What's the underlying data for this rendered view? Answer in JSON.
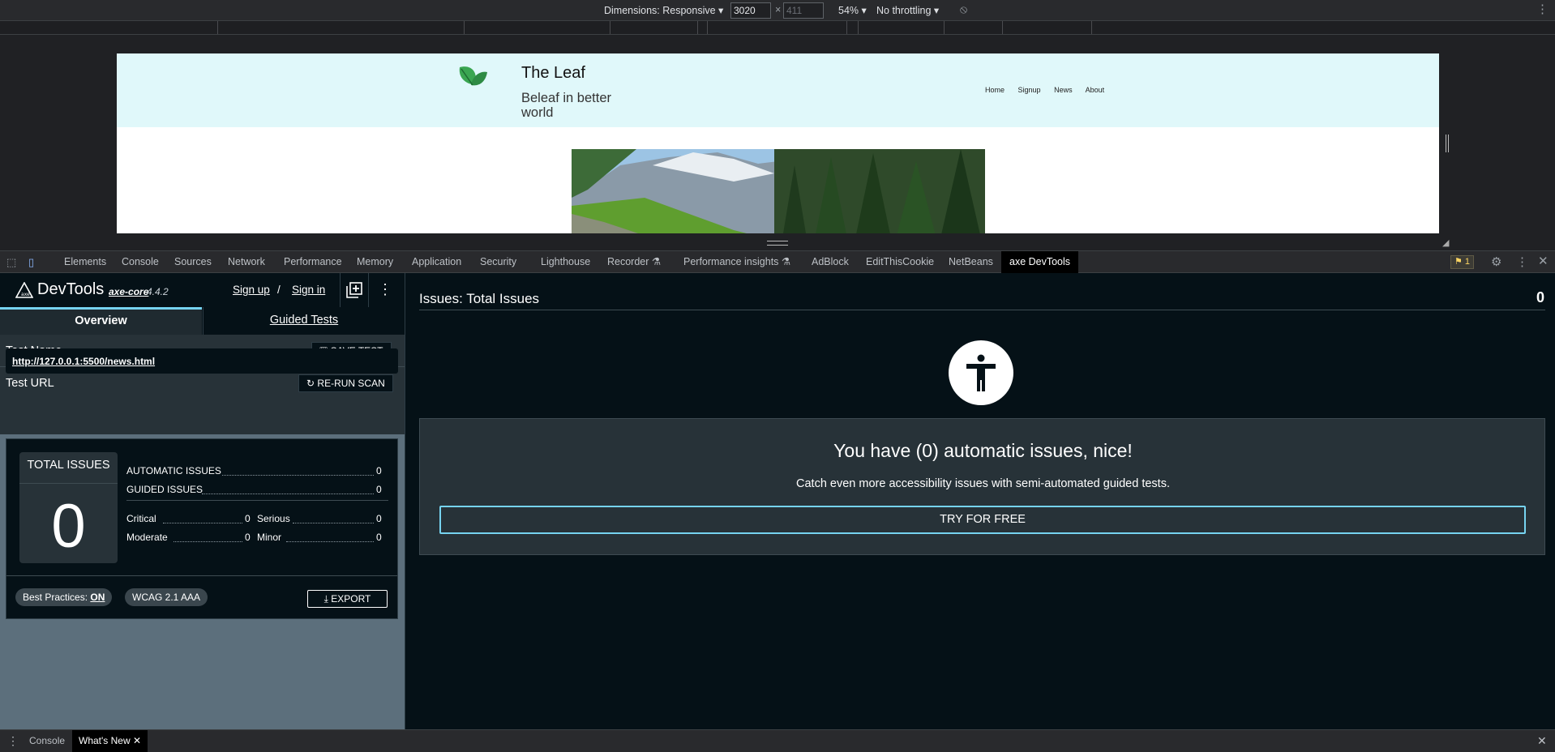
{
  "device_toolbar": {
    "dimensions_label": "Dimensions: Responsive",
    "width_value": "3020",
    "height_placeholder": "411",
    "times": "×",
    "zoom": "54%",
    "throttling": "No throttling"
  },
  "site": {
    "title": "The Leaf",
    "tagline": "Beleaf in better world",
    "nav": [
      "Home",
      "Signup",
      "News",
      "About"
    ]
  },
  "devtools_tabs": [
    "Elements",
    "Console",
    "Sources",
    "Network",
    "Performance",
    "Memory",
    "Application",
    "Security",
    "Lighthouse",
    "Recorder",
    "Performance insights",
    "AdBlock",
    "EditThisCookie",
    "NetBeans",
    "axe DevTools"
  ],
  "issues_badge": "1",
  "axe": {
    "brand": "DevTools",
    "core_label": "axe-core",
    "version": "4.4.2",
    "signup": "Sign up",
    "slash": "/",
    "signin": "Sign in",
    "tabs": {
      "overview": "Overview",
      "guided": "Guided Tests"
    },
    "test_name_label": "Test Name",
    "save_test": "SAVE TEST",
    "test_url_label": "Test URL",
    "rerun_scan": "RE-RUN SCAN",
    "test_url": "http://127.0.0.1:5500/news.html",
    "total_issues_label": "TOTAL ISSUES",
    "total_issues": "0",
    "automatic_label": "AUTOMATIC ISSUES",
    "automatic": "0",
    "guided_label": "GUIDED ISSUES",
    "guided": "0",
    "critical_label": "Critical",
    "critical": "0",
    "serious_label": "Serious",
    "serious": "0",
    "moderate_label": "Moderate",
    "moderate": "0",
    "minor_label": "Minor",
    "minor": "0",
    "best_practices_label": "Best Practices:",
    "best_practices_value": "ON",
    "wcag": "WCAG 2.1 AAA",
    "export": "EXPORT",
    "issues_title": "Issues: Total Issues",
    "issues_count": "0",
    "nice_title": "You have (0) automatic issues, nice!",
    "nice_sub": "Catch even more accessibility issues with semi-automated guided tests.",
    "try_free": "TRY FOR FREE"
  },
  "drawer": {
    "console": "Console",
    "whats_new": "What's New"
  },
  "colors": {
    "accent": "#76d3f0",
    "panel_dark": "#051117",
    "panel_mid": "#273238",
    "header_bg": "#e0f8fa"
  }
}
